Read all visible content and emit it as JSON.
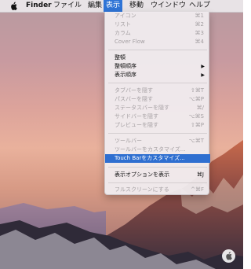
{
  "menubar": {
    "apple": "",
    "finder": "Finder",
    "file": "ファイル",
    "edit": "編集",
    "view": "表示",
    "go": "移動",
    "window": "ウインドウ",
    "help": "ヘルプ"
  },
  "view_menu": {
    "icon_view": {
      "label": "アイコン",
      "shortcut": "⌘1"
    },
    "list_view": {
      "label": "リスト",
      "shortcut": "⌘2"
    },
    "column_view": {
      "label": "カラム",
      "shortcut": "⌘3"
    },
    "cover_flow": {
      "label": "Cover Flow",
      "shortcut": "⌘4"
    },
    "clean_up": {
      "label": "整頓"
    },
    "clean_up_by": {
      "label": "整頓順序",
      "arrow": "▶"
    },
    "sort_by": {
      "label": "表示順序",
      "arrow": "▶"
    },
    "hide_tab_bar": {
      "label": "タブバーを隠す",
      "shortcut": "⇧⌘T"
    },
    "hide_path_bar": {
      "label": "パスバーを隠す",
      "shortcut": "⌥⌘P"
    },
    "hide_status_bar": {
      "label": "ステータスバーを隠す",
      "shortcut": "⌘/"
    },
    "hide_sidebar": {
      "label": "サイドバーを隠す",
      "shortcut": "⌥⌘S"
    },
    "hide_preview": {
      "label": "プレビューを隠す",
      "shortcut": "⇧⌘P"
    },
    "toolbar": {
      "label": "ツールバー",
      "shortcut": "⌥⌘T"
    },
    "customize_toolbar": {
      "label": "ツールバーをカスタマイズ..."
    },
    "customize_touch_bar": {
      "label": "Touch Barをカスタマイズ..."
    },
    "show_view_options": {
      "label": "表示オプションを表示",
      "shortcut": "⌘J"
    },
    "enter_full_screen": {
      "label": "フルスクリーンにする",
      "shortcut": "^⌘F"
    }
  },
  "colors": {
    "highlight": "#2f6fd0",
    "disabled_text": "#a5a0a3",
    "menu_bg": "#f0ecef"
  }
}
